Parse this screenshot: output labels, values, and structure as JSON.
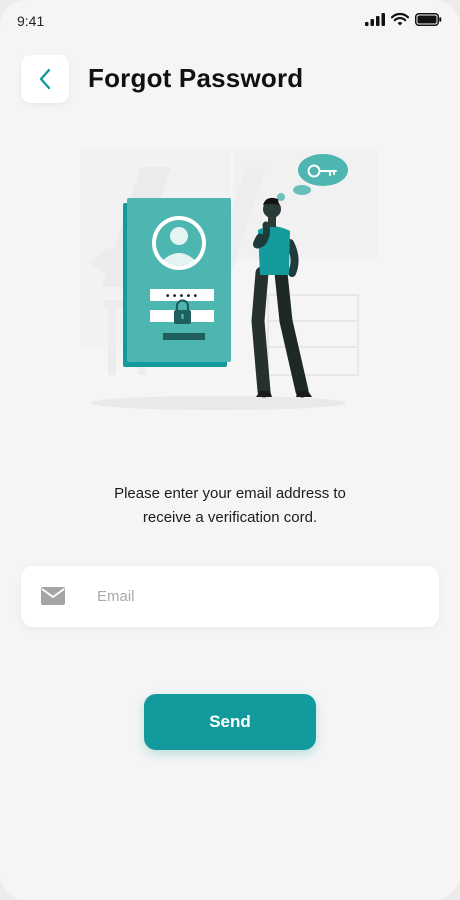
{
  "status_bar": {
    "time": "9:41",
    "icons": [
      "signal-icon",
      "wifi-icon",
      "battery-icon"
    ]
  },
  "header": {
    "back_icon": "chevron-left-icon",
    "title": "Forgot Password"
  },
  "illustration": {
    "subject": "person-thinking-with-locked-profile-card",
    "password_mask": "•••••"
  },
  "instruction": {
    "line1": "Please enter your email address to",
    "line2": "receive a verification cord."
  },
  "email_field": {
    "icon": "envelope-icon",
    "placeholder": "Email",
    "value": ""
  },
  "send_button": {
    "label": "Send"
  },
  "colors": {
    "accent": "#139a9c",
    "illustration_teal": "#4db6b0",
    "background": "#f5f5f5",
    "card": "#ffffff",
    "placeholder": "#a9a9a9"
  }
}
